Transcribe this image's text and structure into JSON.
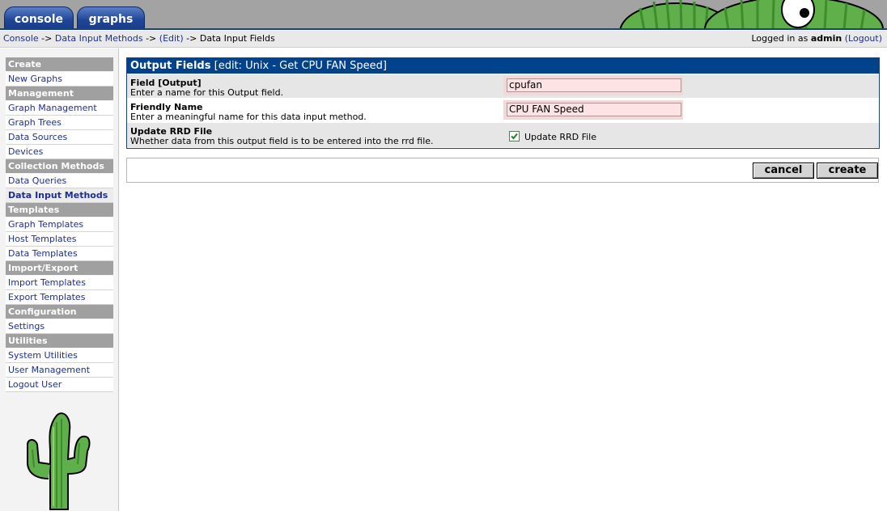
{
  "tabs": {
    "console": "console",
    "graphs": "graphs"
  },
  "breadcrumb": {
    "console": "Console",
    "sep1": " -> ",
    "data_input_methods": "Data Input Methods",
    "sep2": " -> ",
    "edit": "(Edit)",
    "sep3": " -> ",
    "current": "Data Input Fields"
  },
  "login": {
    "prefix": "Logged in as ",
    "user": "admin",
    "logout": "(Logout)"
  },
  "sidebar": {
    "sections": [
      {
        "header": "Create",
        "items": [
          "New Graphs"
        ]
      },
      {
        "header": "Management",
        "items": [
          "Graph Management",
          "Graph Trees",
          "Data Sources",
          "Devices"
        ]
      },
      {
        "header": "Collection Methods",
        "items": [
          "Data Queries",
          "Data Input Methods"
        ]
      },
      {
        "header": "Templates",
        "items": [
          "Graph Templates",
          "Host Templates",
          "Data Templates"
        ]
      },
      {
        "header": "Import/Export",
        "items": [
          "Import Templates",
          "Export Templates"
        ]
      },
      {
        "header": "Configuration",
        "items": [
          "Settings"
        ]
      },
      {
        "header": "Utilities",
        "items": [
          "System Utilities",
          "User Management",
          "Logout User"
        ]
      }
    ],
    "active_item": "Data Input Methods"
  },
  "form": {
    "title": "Output Fields",
    "subtitle": "[edit: Unix - Get CPU FAN Speed]",
    "fields": [
      {
        "name": "Field [Output]",
        "description": "Enter a name for this Output field.",
        "value": "cpufan"
      },
      {
        "name": "Friendly Name",
        "description": "Enter a meaningful name for this data input method.",
        "value": "CPU FAN Speed"
      },
      {
        "name": "Update RRD File",
        "description": "Whether data from this output field is to be entered into the rrd file.",
        "checkbox_label": "Update RRD File",
        "checked": true
      }
    ]
  },
  "buttons": {
    "cancel": "cancel",
    "create": "create"
  },
  "colors": {
    "header_blue": "#00438c",
    "link_blue": "#1d2e96",
    "input_pink": "#fde3e3",
    "sidebar_header": "#a0a0a0"
  }
}
